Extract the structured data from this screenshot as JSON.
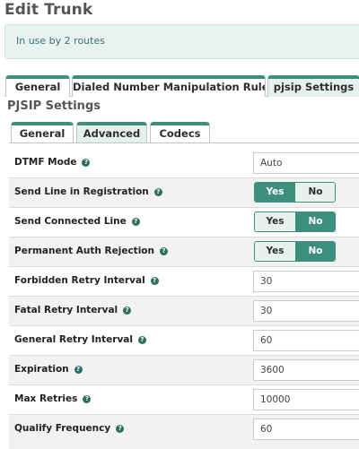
{
  "page": {
    "title": "Edit Trunk"
  },
  "notice": {
    "text": "In use by 2 routes"
  },
  "outer_tabs": [
    {
      "label": "General",
      "active": false
    },
    {
      "label": "Dialed Number Manipulation Rules",
      "active": false
    },
    {
      "label": "pjsip Settings",
      "active": true
    }
  ],
  "section": {
    "heading": "PJSIP Settings"
  },
  "inner_tabs": [
    {
      "label": "General",
      "active": false
    },
    {
      "label": "Advanced",
      "active": true
    },
    {
      "label": "Codecs",
      "active": false
    }
  ],
  "toggle_labels": {
    "yes": "Yes",
    "no": "No"
  },
  "settings": [
    {
      "label": "DTMF Mode",
      "type": "select",
      "value": "Auto"
    },
    {
      "label": "Send Line in Registration",
      "type": "toggle",
      "value": "Yes"
    },
    {
      "label": "Send Connected Line",
      "type": "toggle",
      "value": "No"
    },
    {
      "label": "Permanent Auth Rejection",
      "type": "toggle",
      "value": "No"
    },
    {
      "label": "Forbidden Retry Interval",
      "type": "text",
      "value": "30"
    },
    {
      "label": "Fatal Retry Interval",
      "type": "text",
      "value": "30"
    },
    {
      "label": "General Retry Interval",
      "type": "text",
      "value": "60"
    },
    {
      "label": "Expiration",
      "type": "text",
      "value": "3600"
    },
    {
      "label": "Max Retries",
      "type": "text",
      "value": "10000"
    },
    {
      "label": "Qualify Frequency",
      "type": "text",
      "value": "60"
    }
  ],
  "icons": {
    "help": "question-circle-icon"
  },
  "colors": {
    "accent": "#3e8e7e",
    "notice_bg": "#e8f3f1"
  }
}
